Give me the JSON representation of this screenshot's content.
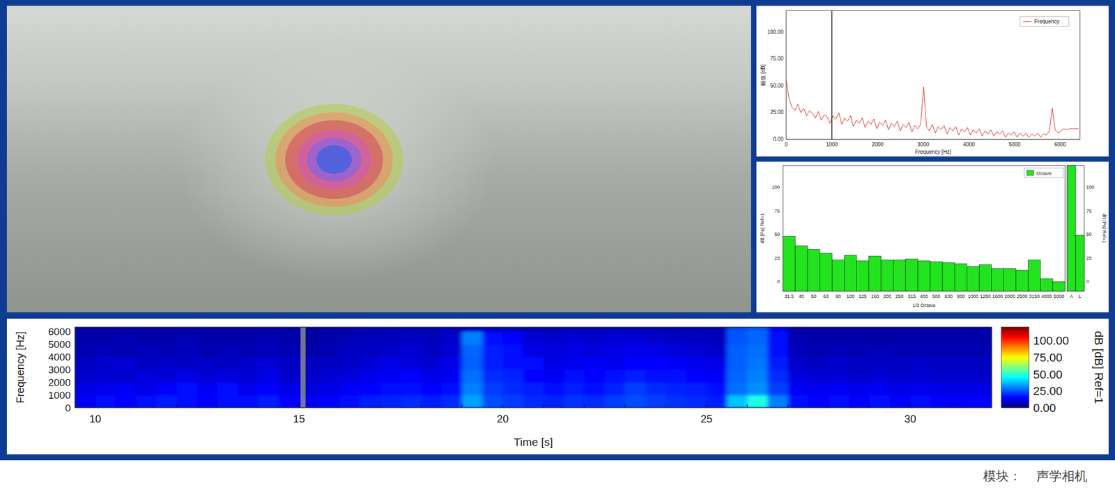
{
  "spectrum": {
    "y_label": "幅值 [dB]",
    "x_label": "Frequency [Hz]",
    "legend": "Frequency",
    "y_ticks": [
      "0.00",
      "25.00",
      "50.00",
      "75.00",
      "100.00"
    ],
    "x_ticks": [
      "0",
      "1000",
      "2000",
      "3000",
      "4000",
      "5000",
      "6000"
    ],
    "step_hz": 64,
    "cursor_hz": 1000,
    "values": [
      55,
      38,
      30,
      27,
      33,
      25,
      29,
      22,
      27,
      24,
      20,
      26,
      18,
      23,
      21,
      15,
      22,
      19,
      25,
      14,
      20,
      17,
      22,
      12,
      18,
      15,
      20,
      11,
      17,
      14,
      19,
      10,
      16,
      13,
      18,
      9,
      15,
      12,
      17,
      8,
      14,
      11,
      16,
      7,
      13,
      10,
      14,
      49,
      12,
      8,
      14,
      6,
      12,
      9,
      13,
      5,
      11,
      8,
      12,
      4,
      10,
      7,
      11,
      4,
      9,
      6,
      10,
      3,
      8,
      5,
      9,
      3,
      7,
      5,
      8,
      2,
      6,
      4,
      7,
      2,
      6,
      3,
      6,
      2,
      5,
      3,
      6,
      2,
      5,
      4,
      8,
      29,
      9,
      6,
      8,
      10,
      9,
      10,
      10,
      10,
      10
    ]
  },
  "octave": {
    "y_label": "dB [Pa] Ref=1",
    "right_y_label": "dB [Pa] Ref=1",
    "x_label": "1/3 Octave",
    "legend": "Octave",
    "y_ticks": [
      "0",
      "25",
      "50",
      "75",
      "100"
    ],
    "right_y_ticks": [
      "0",
      "25",
      "50",
      "75",
      "100"
    ],
    "bands": [
      {
        "label": "31.5",
        "value": 48
      },
      {
        "label": "40",
        "value": 38
      },
      {
        "label": "50",
        "value": 34
      },
      {
        "label": "63",
        "value": 30
      },
      {
        "label": "80",
        "value": 23
      },
      {
        "label": "100",
        "value": 28
      },
      {
        "label": "125",
        "value": 22
      },
      {
        "label": "160",
        "value": 27
      },
      {
        "label": "200",
        "value": 23
      },
      {
        "label": "250",
        "value": 23
      },
      {
        "label": "315",
        "value": 24
      },
      {
        "label": "400",
        "value": 22
      },
      {
        "label": "500",
        "value": 21
      },
      {
        "label": "630",
        "value": 20
      },
      {
        "label": "800",
        "value": 19
      },
      {
        "label": "1000",
        "value": 16
      },
      {
        "label": "1250",
        "value": 18
      },
      {
        "label": "1600",
        "value": 14
      },
      {
        "label": "2000",
        "value": 14
      },
      {
        "label": "2500",
        "value": 12
      },
      {
        "label": "3150",
        "value": 23
      },
      {
        "label": "4000",
        "value": 3
      },
      {
        "label": "5000",
        "value": 0
      }
    ],
    "totals": [
      {
        "label": "A",
        "value": 125
      },
      {
        "label": "L",
        "value": 49
      }
    ]
  },
  "spectrogram": {
    "y_label": "Frequency [Hz]",
    "x_label": "Time [s]",
    "y_ticks": [
      "0",
      "1000",
      "2000",
      "3000",
      "4000",
      "5000",
      "6000"
    ],
    "x_ticks": [
      "10",
      "15",
      "20",
      "25",
      "30"
    ],
    "colorbar_ticks": [
      "0.00",
      "25.00",
      "50.00",
      "75.00",
      "100.00"
    ],
    "colorbar_label": "dB [dB] Ref=1",
    "start_s": 9.5,
    "step_s": 0.5,
    "band_hz": 1000,
    "cursor_s": 15.1,
    "columns": [
      [
        14,
        12,
        9,
        8,
        6,
        5,
        4
      ],
      [
        16,
        13,
        10,
        9,
        7,
        5,
        4
      ],
      [
        15,
        14,
        9,
        10,
        6,
        6,
        4
      ],
      [
        17,
        12,
        11,
        8,
        7,
        5,
        4
      ],
      [
        18,
        15,
        10,
        9,
        6,
        5,
        4
      ],
      [
        16,
        17,
        12,
        8,
        7,
        6,
        4
      ],
      [
        15,
        14,
        10,
        9,
        6,
        5,
        4
      ],
      [
        17,
        16,
        11,
        8,
        7,
        5,
        4
      ],
      [
        16,
        13,
        10,
        9,
        6,
        5,
        4
      ],
      [
        18,
        15,
        12,
        10,
        7,
        6,
        4
      ],
      [
        15,
        12,
        9,
        8,
        6,
        5,
        4
      ],
      [
        14,
        11,
        9,
        8,
        5,
        4,
        3
      ],
      [
        15,
        12,
        10,
        8,
        6,
        5,
        4
      ],
      [
        17,
        14,
        11,
        9,
        8,
        6,
        4
      ],
      [
        18,
        15,
        13,
        10,
        8,
        7,
        5
      ],
      [
        19,
        16,
        14,
        12,
        9,
        7,
        5
      ],
      [
        20,
        17,
        15,
        11,
        10,
        8,
        5
      ],
      [
        18,
        15,
        12,
        10,
        8,
        7,
        5
      ],
      [
        20,
        17,
        14,
        12,
        10,
        9,
        6
      ],
      [
        34,
        30,
        28,
        26,
        27,
        30,
        8
      ],
      [
        24,
        22,
        20,
        18,
        18,
        16,
        7
      ],
      [
        22,
        20,
        19,
        17,
        16,
        15,
        6
      ],
      [
        20,
        18,
        15,
        16,
        12,
        10,
        5
      ],
      [
        19,
        17,
        14,
        12,
        11,
        9,
        5
      ],
      [
        21,
        18,
        16,
        13,
        12,
        10,
        6
      ],
      [
        20,
        17,
        15,
        14,
        11,
        9,
        5
      ],
      [
        22,
        19,
        16,
        13,
        12,
        10,
        6
      ],
      [
        24,
        22,
        18,
        15,
        13,
        10,
        6
      ],
      [
        22,
        20,
        17,
        15,
        12,
        9,
        5
      ],
      [
        21,
        19,
        16,
        14,
        11,
        8,
        5
      ],
      [
        20,
        18,
        15,
        13,
        10,
        8,
        5
      ],
      [
        18,
        16,
        14,
        12,
        9,
        7,
        5
      ],
      [
        38,
        28,
        27,
        26,
        26,
        25,
        24
      ],
      [
        48,
        32,
        30,
        29,
        28,
        27,
        26
      ],
      [
        30,
        22,
        20,
        18,
        17,
        16,
        14
      ],
      [
        16,
        14,
        11,
        9,
        7,
        6,
        4
      ],
      [
        15,
        13,
        10,
        8,
        6,
        5,
        4
      ],
      [
        16,
        14,
        10,
        9,
        7,
        5,
        4
      ],
      [
        15,
        13,
        9,
        8,
        6,
        5,
        4
      ],
      [
        16,
        14,
        10,
        8,
        7,
        5,
        4
      ],
      [
        15,
        12,
        9,
        8,
        6,
        5,
        4
      ],
      [
        16,
        13,
        10,
        9,
        6,
        5,
        4
      ],
      [
        15,
        12,
        9,
        8,
        6,
        5,
        4
      ],
      [
        14,
        12,
        9,
        8,
        6,
        5,
        4
      ],
      [
        15,
        12,
        9,
        8,
        6,
        5,
        4
      ]
    ]
  },
  "footer": {
    "label": "模块：",
    "value": "声学相机"
  }
}
